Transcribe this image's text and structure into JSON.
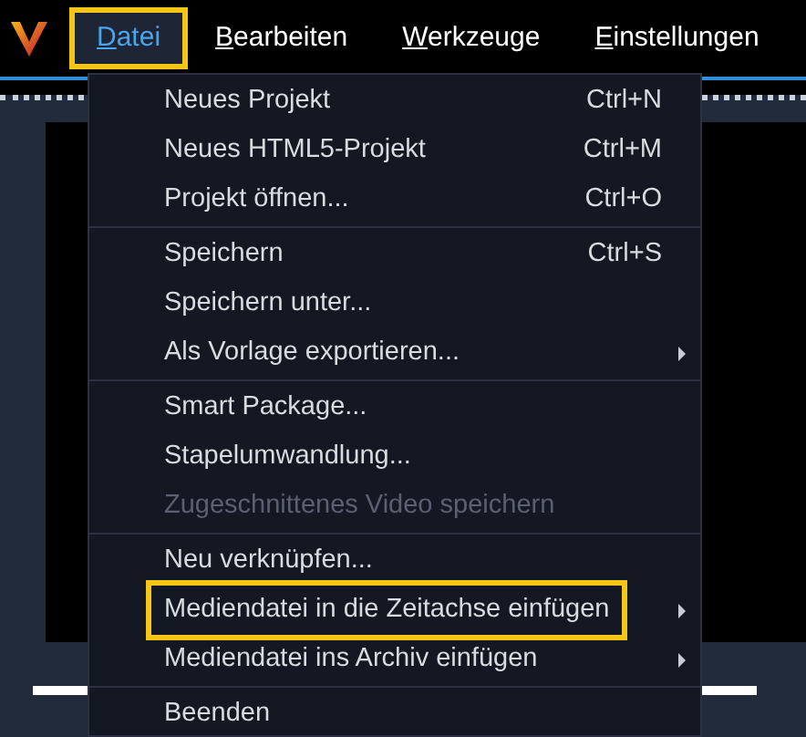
{
  "menu_bar": [
    {
      "mnemonic": "D",
      "rest": "atei",
      "selected": true,
      "highlighted": true
    },
    {
      "mnemonic": "B",
      "rest": "earbeiten",
      "selected": false,
      "highlighted": false
    },
    {
      "mnemonic": "W",
      "rest": "erkzeuge",
      "selected": false,
      "highlighted": false
    },
    {
      "mnemonic": "E",
      "rest": "instellungen",
      "selected": false,
      "highlighted": false
    }
  ],
  "menu": {
    "groups": [
      {
        "items": [
          {
            "label": "Neues Projekt",
            "shortcut": "Ctrl+N",
            "disabled": false,
            "submenu": false,
            "highlighted": false
          },
          {
            "label": "Neues HTML5-Projekt",
            "shortcut": "Ctrl+M",
            "disabled": false,
            "submenu": false,
            "highlighted": false
          },
          {
            "label": "Projekt öffnen...",
            "shortcut": "Ctrl+O",
            "disabled": false,
            "submenu": false,
            "highlighted": false
          }
        ]
      },
      {
        "items": [
          {
            "label": "Speichern",
            "shortcut": "Ctrl+S",
            "disabled": false,
            "submenu": false,
            "highlighted": false
          },
          {
            "label": "Speichern unter...",
            "disabled": false,
            "submenu": false,
            "highlighted": false
          },
          {
            "label": "Als Vorlage exportieren...",
            "disabled": false,
            "submenu": true,
            "highlighted": false
          }
        ]
      },
      {
        "items": [
          {
            "label": "Smart Package...",
            "disabled": false,
            "submenu": false,
            "highlighted": false
          },
          {
            "label": "Stapelumwandlung...",
            "disabled": false,
            "submenu": false,
            "highlighted": false
          },
          {
            "label": "Zugeschnittenes Video speichern",
            "disabled": true,
            "submenu": false,
            "highlighted": false
          }
        ]
      },
      {
        "items": [
          {
            "label": "Neu verknüpfen...",
            "disabled": false,
            "submenu": false,
            "highlighted": false
          },
          {
            "label": "Mediendatei in die Zeitachse einfügen",
            "disabled": false,
            "submenu": true,
            "highlighted": true
          },
          {
            "label": "Mediendatei ins Archiv einfügen",
            "disabled": false,
            "submenu": true,
            "highlighted": false
          }
        ]
      },
      {
        "items": [
          {
            "label": "Beenden",
            "disabled": false,
            "submenu": false,
            "highlighted": false
          }
        ]
      }
    ]
  }
}
